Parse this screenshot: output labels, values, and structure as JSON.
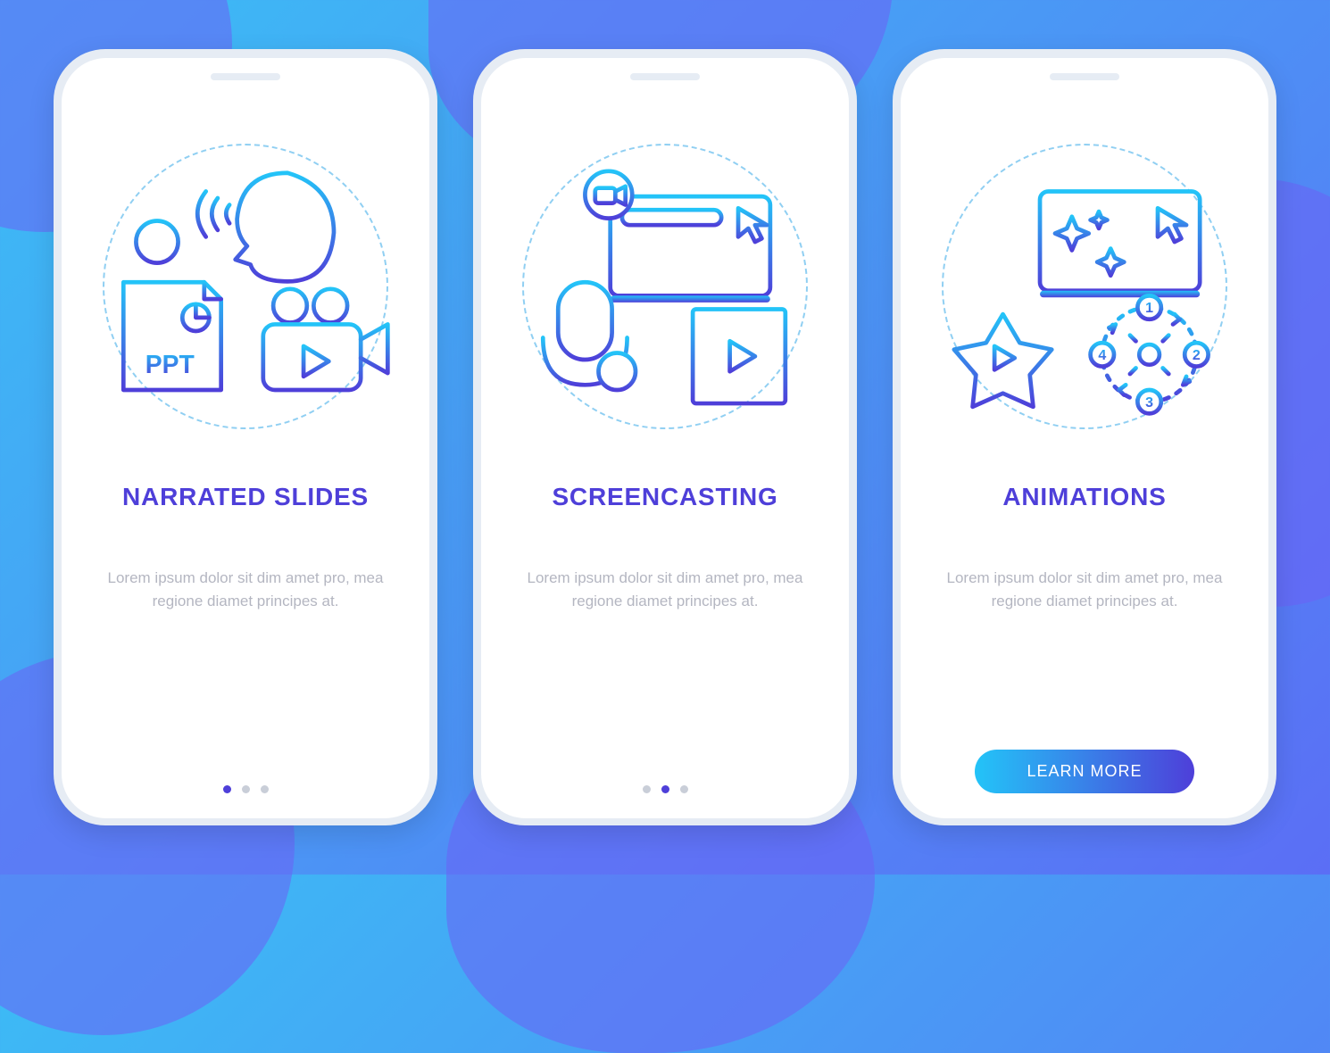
{
  "colors": {
    "gradient_start": "#23C4F8",
    "gradient_end": "#4E3FD9",
    "title": "#4E3FD9",
    "body": "#B4B6C1",
    "dot_inactive": "#C9CED8",
    "bg_gradient_start": "#3BBEF5",
    "bg_gradient_end": "#5B6EF5"
  },
  "cta_label": "LEARN MORE",
  "lorem": "Lorem ipsum dolor sit dim amet pro, mea regione diamet principes at.",
  "screens": [
    {
      "title": "NARRATED SLIDES",
      "body_ref": "lorem",
      "badge_text": "PPT",
      "active_dot_index": 0,
      "has_cta": false,
      "icon": "narrated-slides"
    },
    {
      "title": "SCREENCASTING",
      "body_ref": "lorem",
      "active_dot_index": 1,
      "has_cta": false,
      "icon": "screencasting"
    },
    {
      "title": "ANIMATIONS",
      "body_ref": "lorem",
      "active_dot_index": 2,
      "has_cta": true,
      "icon": "animations",
      "step_numbers": [
        "1",
        "2",
        "3",
        "4"
      ]
    }
  ],
  "dot_count": 3
}
